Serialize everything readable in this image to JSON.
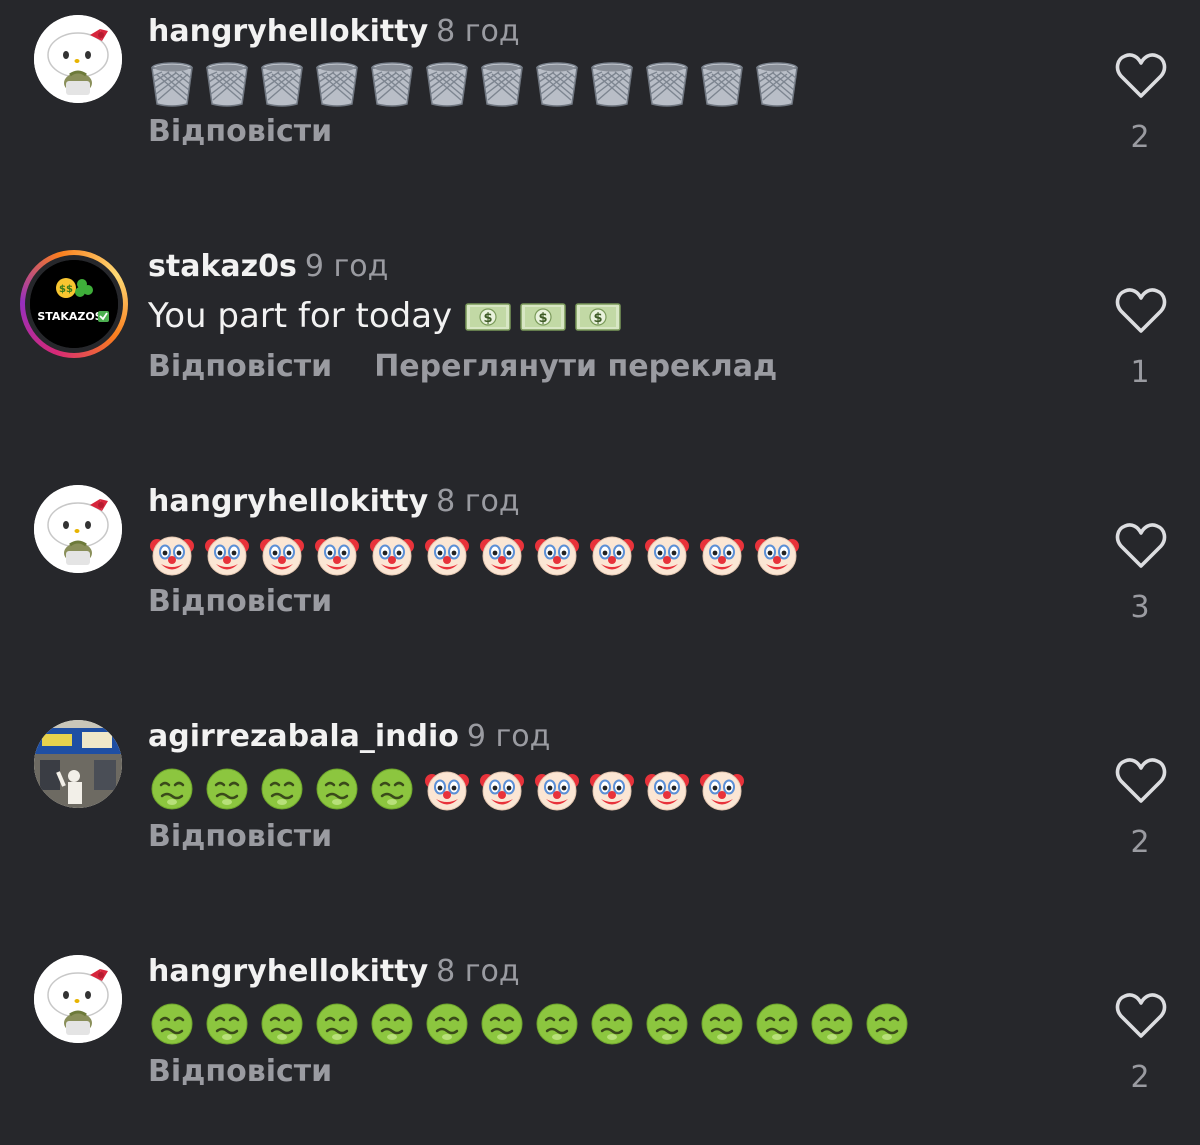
{
  "comments": [
    {
      "username": "hangryhellokitty",
      "time": "8 год",
      "text": "",
      "emojis": [
        "wastebasket",
        "wastebasket",
        "wastebasket",
        "wastebasket",
        "wastebasket",
        "wastebasket",
        "wastebasket",
        "wastebasket",
        "wastebasket",
        "wastebasket",
        "wastebasket",
        "wastebasket"
      ],
      "reply_label": "Відповісти",
      "translate_label": "",
      "likes": "2",
      "avatar": "hello-kitty-avatar"
    },
    {
      "username": "stakaz0s",
      "time": "9 год",
      "text": "You part for today",
      "emojis": [
        "dollar-banknote",
        "dollar-banknote",
        "dollar-banknote"
      ],
      "reply_label": "Відповісти",
      "translate_label": "Переглянути переклад",
      "likes": "1",
      "avatar": "stakazos-avatar",
      "avatar_text": "STAKAZOS"
    },
    {
      "username": "hangryhellokitty",
      "time": "8 год",
      "text": "",
      "emojis": [
        "clown-face",
        "clown-face",
        "clown-face",
        "clown-face",
        "clown-face",
        "clown-face",
        "clown-face",
        "clown-face",
        "clown-face",
        "clown-face",
        "clown-face",
        "clown-face"
      ],
      "reply_label": "Відповісти",
      "translate_label": "",
      "likes": "3",
      "avatar": "hello-kitty-avatar"
    },
    {
      "username": "agirrezabala_indio",
      "time": "9 год",
      "text": "",
      "emojis": [
        "nauseated-face",
        "nauseated-face",
        "nauseated-face",
        "nauseated-face",
        "nauseated-face",
        "clown-face",
        "clown-face",
        "clown-face",
        "clown-face",
        "clown-face",
        "clown-face"
      ],
      "reply_label": "Відповісти",
      "translate_label": "",
      "likes": "2",
      "avatar": "storefront-photo-avatar"
    },
    {
      "username": "hangryhellokitty",
      "time": "8 год",
      "text": "",
      "emojis": [
        "nauseated-face",
        "nauseated-face",
        "nauseated-face",
        "nauseated-face",
        "nauseated-face",
        "nauseated-face",
        "nauseated-face",
        "nauseated-face",
        "nauseated-face",
        "nauseated-face",
        "nauseated-face",
        "nauseated-face",
        "nauseated-face",
        "nauseated-face"
      ],
      "reply_label": "Відповісти",
      "translate_label": "",
      "likes": "2",
      "avatar": "hello-kitty-avatar"
    }
  ],
  "colors": {
    "background": "#26272b",
    "text": "#f2f2f2",
    "muted": "#9a9ba1"
  }
}
